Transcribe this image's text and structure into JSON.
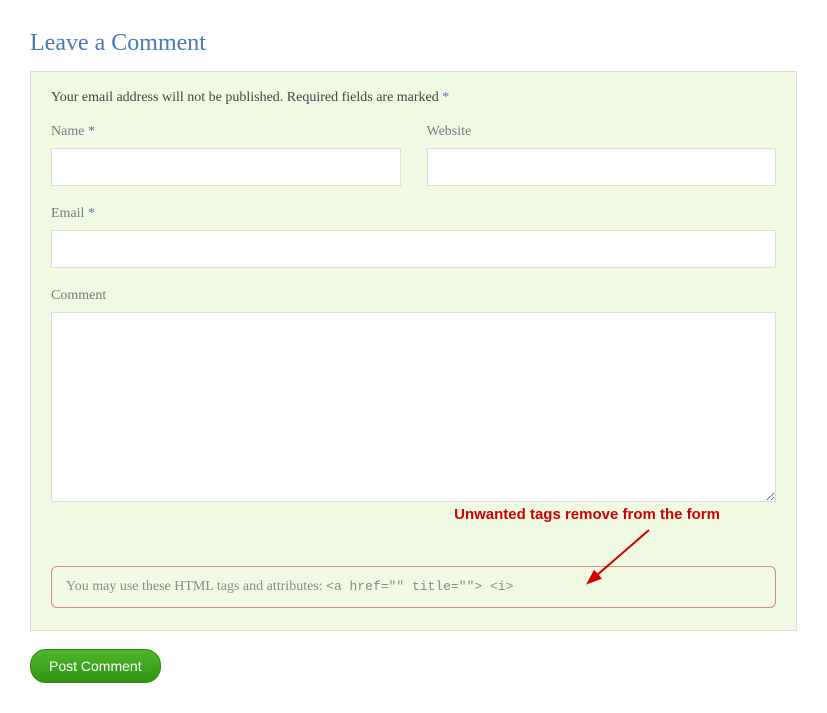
{
  "heading": "Leave a Comment",
  "note_prefix": "Your email address will not be published. Required fields are marked ",
  "note_star": "*",
  "fields": {
    "name": {
      "label": "Name ",
      "star": "*",
      "value": ""
    },
    "website": {
      "label": "Website",
      "value": ""
    },
    "email": {
      "label": "Email ",
      "star": "*",
      "value": ""
    },
    "comment": {
      "label": "Comment",
      "value": ""
    }
  },
  "annotation": "Unwanted tags remove from the form",
  "hint": {
    "text": "You may use these HTML tags and attributes: ",
    "code": "<a href=\"\" title=\"\"> <i>"
  },
  "submit_label": "Post Comment"
}
